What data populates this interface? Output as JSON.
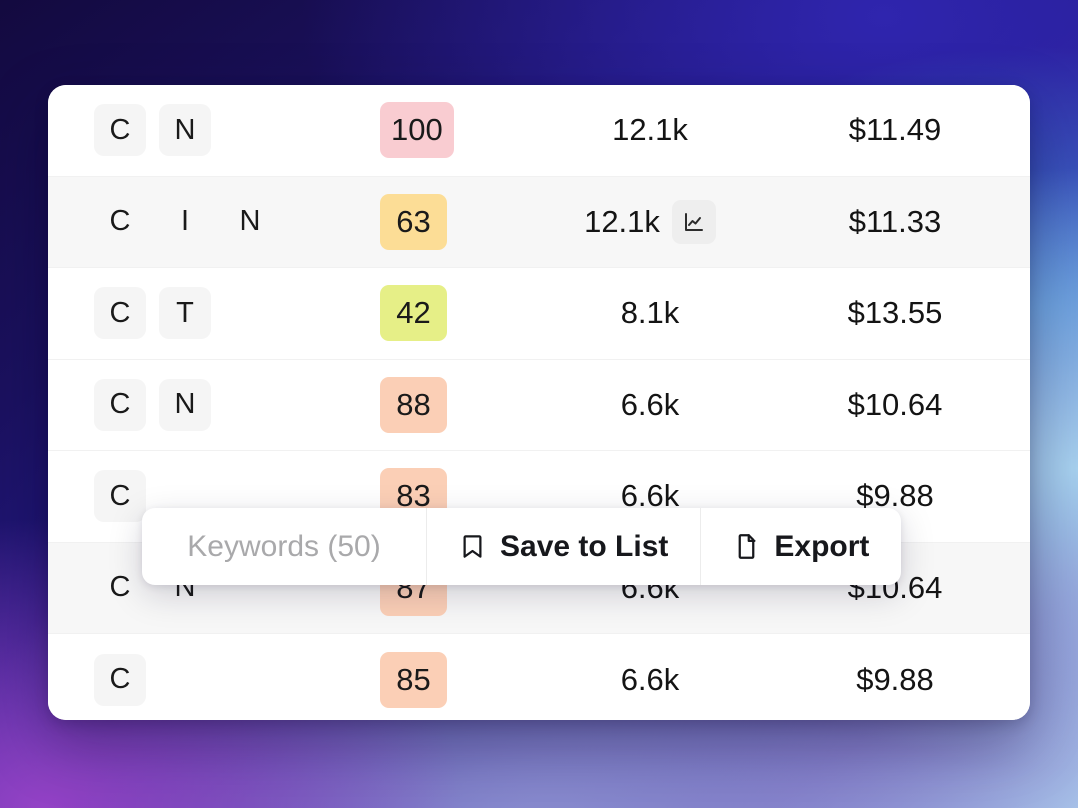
{
  "background": {
    "accent_indigo": "#241a8a",
    "accent_purple": "#9442c6",
    "accent_blue": "#3f7fd4",
    "accent_skyblue": "#a8d2f0"
  },
  "table": {
    "columns": [
      "tags",
      "score",
      "volume",
      "cpc"
    ],
    "rows": [
      {
        "tags": [
          "C",
          "N"
        ],
        "score": "100",
        "score_color": "#f9ccd1",
        "volume": "12.1k",
        "cpc": "$11.49",
        "hovered": false,
        "has_chart_icon": false
      },
      {
        "tags": [
          "C",
          "I",
          "N"
        ],
        "score": "63",
        "score_color": "#fcdd96",
        "volume": "12.1k",
        "cpc": "$11.33",
        "hovered": true,
        "has_chart_icon": true,
        "chart_icon": "line-chart-icon"
      },
      {
        "tags": [
          "C",
          "T"
        ],
        "score": "42",
        "score_color": "#e6ef87",
        "volume": "8.1k",
        "cpc": "$13.55",
        "hovered": false,
        "has_chart_icon": false
      },
      {
        "tags": [
          "C",
          "N"
        ],
        "score": "88",
        "score_color": "#fbcfb6",
        "volume": "6.6k",
        "cpc": "$10.64",
        "hovered": false,
        "has_chart_icon": false
      },
      {
        "tags": [
          "C"
        ],
        "score": "83",
        "score_color": "#fbcfb6",
        "volume": "6.6k",
        "cpc": "$9.88",
        "hovered": false,
        "has_chart_icon": false
      },
      {
        "tags": [
          "C",
          "N"
        ],
        "score": "87",
        "score_color": "#fbcfb6",
        "volume": "6.6k",
        "cpc": "$10.64",
        "hovered": true,
        "has_chart_icon": false
      },
      {
        "tags": [
          "C"
        ],
        "score": "85",
        "score_color": "#fbcfb6",
        "volume": "6.6k",
        "cpc": "$9.88",
        "hovered": false,
        "has_chart_icon": false
      }
    ]
  },
  "action_bar": {
    "selection_label": "Keywords (50)",
    "save_label": "Save to List",
    "save_icon": "bookmark-icon",
    "export_label": "Export",
    "export_icon": "file-icon"
  }
}
